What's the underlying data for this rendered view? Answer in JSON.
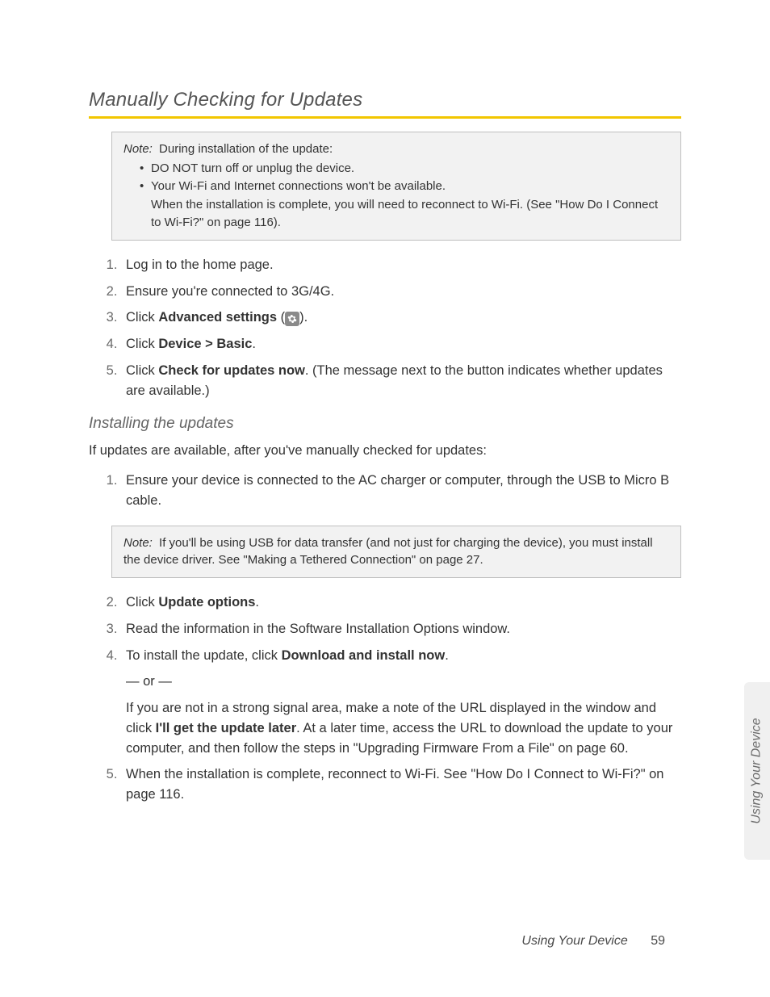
{
  "section_title": "Manually Checking for Updates",
  "note1": {
    "label": "Note:",
    "intro": "During installation of the update:",
    "bullets": [
      "DO NOT turn off or unplug the device.",
      "Your Wi-Fi and Internet connections won't be available."
    ],
    "after": "When the installation is complete, you will need to reconnect to Wi-Fi. (See \"How Do I Connect to Wi-Fi?\" on page 116)."
  },
  "steps1": {
    "s1": "Log in to the home page.",
    "s2": "Ensure you're connected to 3G/4G.",
    "s3_pre": "Click ",
    "s3_bold": "Advanced settings",
    "s3_post_open": " (",
    "s3_post_close": ").",
    "s4_pre": "Click ",
    "s4_bold": "Device > Basic",
    "s4_post": ".",
    "s5_pre": "Click ",
    "s5_bold": "Check for updates now",
    "s5_post": ". (The message next to the button indicates whether updates are available.)"
  },
  "subheading": "Installing the updates",
  "intro2": "If updates are available, after you've manually checked for updates:",
  "steps2": {
    "s1": "Ensure your device is connected to the AC charger or computer, through the USB to Micro B cable."
  },
  "note2": {
    "label": "Note:",
    "text": "If you'll be using USB for data transfer (and not just for charging the device), you must install the device driver. See \"Making a Tethered Connection\" on page 27."
  },
  "steps3": {
    "s2_pre": "Click ",
    "s2_bold": "Update options",
    "s2_post": ".",
    "s3": "Read the information in the Software Installation Options window.",
    "s4_pre": "To install the update, click ",
    "s4_bold": "Download and install now",
    "s4_post": ".",
    "s4_or": "— or —",
    "s4_alt_pre": "If you are not in a strong signal area, make a note of the URL displayed in the window and click ",
    "s4_alt_bold": "I'll get the update later",
    "s4_alt_post": ". At a later time, access the URL to download the update to your computer, and then follow the steps in \"Upgrading Firmware From a File\" on page 60.",
    "s5": "When the installation is complete, reconnect to Wi-Fi. See \"How Do I Connect to Wi-Fi?\" on page 116."
  },
  "side_tab": "Using Your Device",
  "footer": {
    "label": "Using Your Device",
    "page": "59"
  },
  "icons": {
    "gear": "gear-icon"
  }
}
